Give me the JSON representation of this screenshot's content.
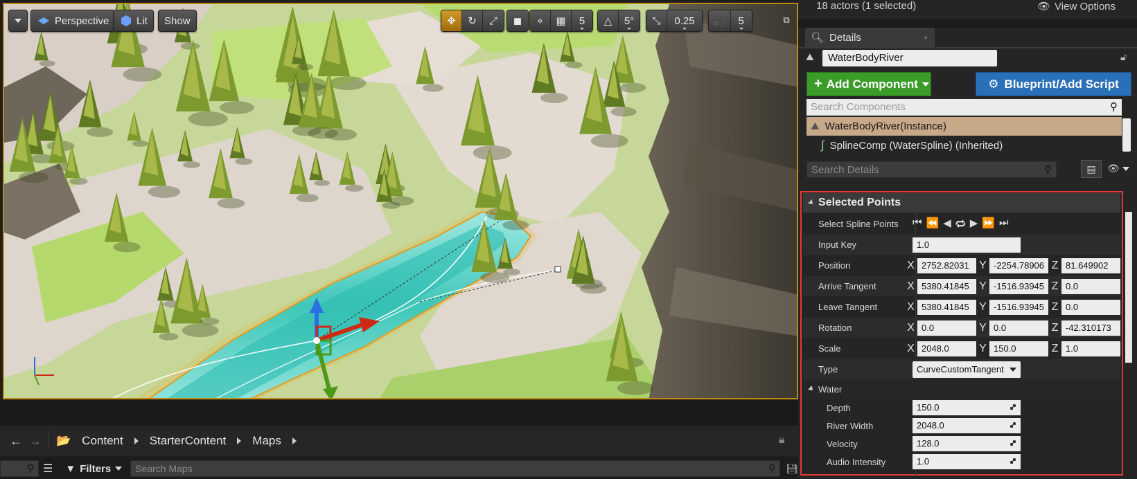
{
  "viewport": {
    "menu_caret": "chevron-down-icon",
    "perspective_label": "Perspective",
    "lit_label": "Lit",
    "show_label": "Show",
    "grid_snap_value": "5",
    "rotate_snap_value": "5°",
    "scale_snap_value": "0.25",
    "camera_speed_value": "5"
  },
  "content_browser": {
    "breadcrumbs": [
      "Content",
      "StarterContent",
      "Maps"
    ],
    "filters_label": "Filters",
    "search_placeholder": "Search Maps"
  },
  "outliner": {
    "status": "18 actors (1 selected)",
    "view_options_label": "View Options"
  },
  "details": {
    "tab_label": "Details",
    "actor_name": "WaterBodyRiver",
    "add_component_label": "Add Component",
    "blueprint_label": "Blueprint/Add Script",
    "search_components_placeholder": "Search Components",
    "root_component": "WaterBodyRiver(Instance)",
    "child_component": "SplineComp (WaterSpline) (Inherited)",
    "search_details_placeholder": "Search Details",
    "section_title": "Selected Points",
    "select_points_label": "Select Spline Points",
    "input_key_label": "Input Key",
    "input_key_value": "1.0",
    "position_label": "Position",
    "position": {
      "x": "2752.82031",
      "y": "-2254.78906",
      "z": "81.649902"
    },
    "arrive_label": "Arrive Tangent",
    "arrive": {
      "x": "5380.41845",
      "y": "-1516.93945",
      "z": "0.0"
    },
    "leave_label": "Leave Tangent",
    "leave": {
      "x": "5380.41845",
      "y": "-1516.93945",
      "z": "0.0"
    },
    "rotation_label": "Rotation",
    "rotation": {
      "x": "0.0",
      "y": "0.0",
      "z": "-42.310173"
    },
    "scale_label": "Scale",
    "scale": {
      "x": "2048.0",
      "y": "150.0",
      "z": "1.0"
    },
    "type_label": "Type",
    "type_value": "CurveCustomTangent",
    "water_label": "Water",
    "depth_label": "Depth",
    "depth_value": "150.0",
    "width_label": "River Width",
    "width_value": "2048.0",
    "velocity_label": "Velocity",
    "velocity_value": "128.0",
    "audio_label": "Audio Intensity",
    "audio_value": "1.0"
  },
  "colors": {
    "accent_orange": "#d19a2a",
    "add_component_green": "#3c9c2a",
    "blueprint_blue": "#2a70b8",
    "selected_component": "#c7a888",
    "highlight_red": "#e23a3a"
  }
}
